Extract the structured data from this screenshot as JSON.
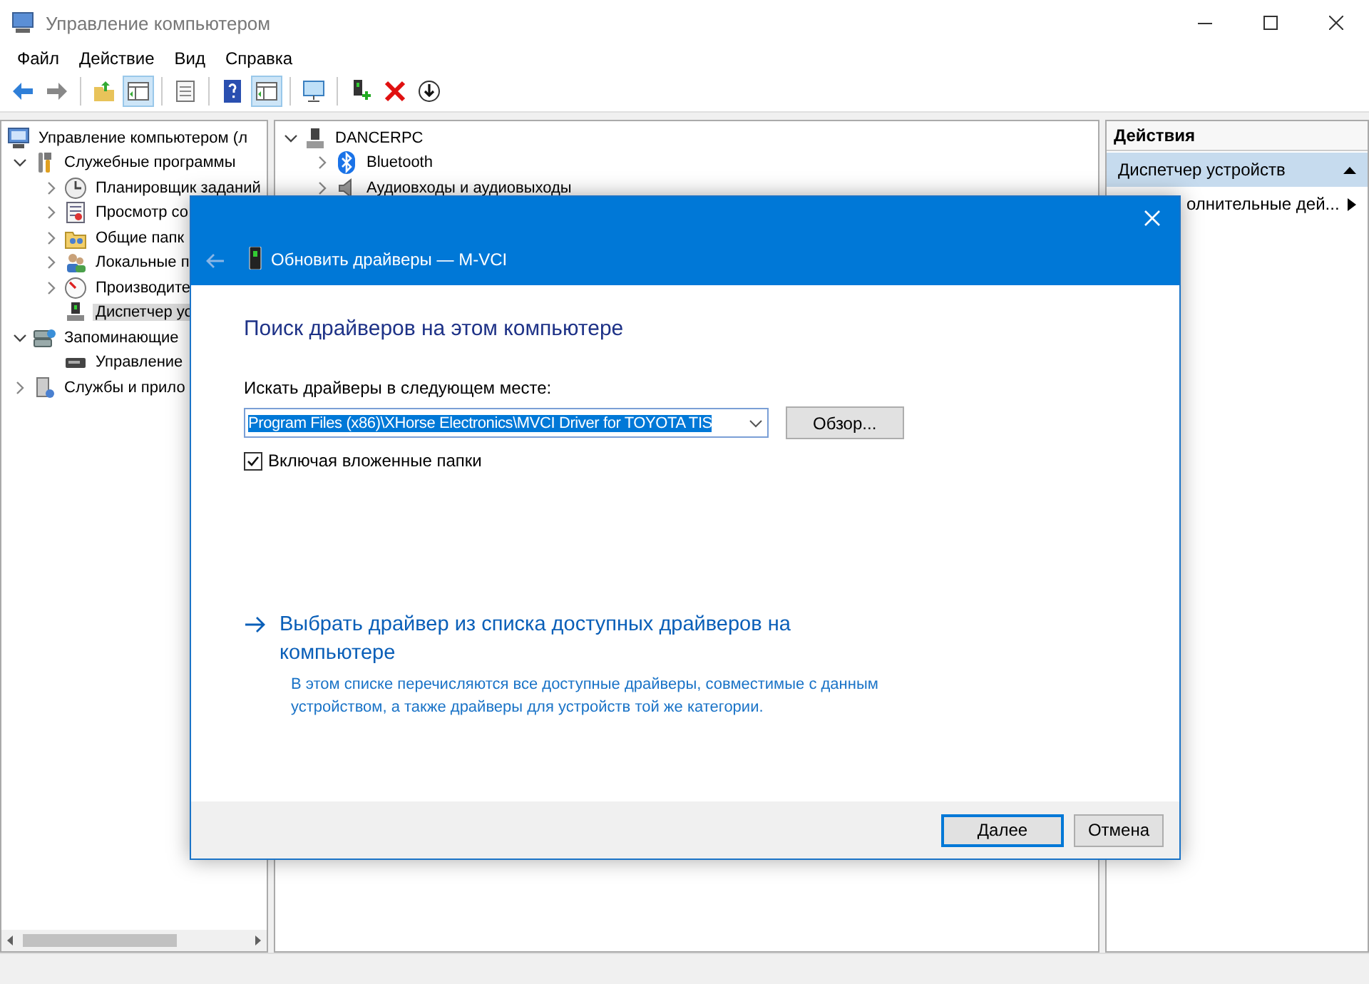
{
  "window": {
    "title": "Управление компьютером"
  },
  "menu": [
    "Файл",
    "Действие",
    "Вид",
    "Справка"
  ],
  "toolbar": [
    {
      "kind": "back",
      "pressed": false
    },
    {
      "kind": "forward",
      "pressed": false
    },
    {
      "kind": "separator"
    },
    {
      "kind": "up",
      "pressed": false
    },
    {
      "kind": "panel",
      "pressed": true
    },
    {
      "kind": "separator"
    },
    {
      "kind": "properties",
      "pressed": false
    },
    {
      "kind": "separator"
    },
    {
      "kind": "help",
      "pressed": false
    },
    {
      "kind": "panel",
      "pressed": true
    },
    {
      "kind": "separator"
    },
    {
      "kind": "monitor",
      "pressed": false
    },
    {
      "kind": "separator"
    },
    {
      "kind": "device",
      "pressed": false
    },
    {
      "kind": "delete",
      "pressed": false
    },
    {
      "kind": "download",
      "pressed": false
    }
  ],
  "navigation_tree": [
    {
      "label": "Управление компьютером (л",
      "kind": "computer",
      "selected": false,
      "children": [
        {
          "label": "Служебные программы",
          "kind": "tools",
          "expanded": true,
          "selected": false,
          "children": [
            {
              "label": "Планировщик заданий",
              "kind": "clock",
              "expanded": false,
              "selected": false
            },
            {
              "label": "Просмотр со",
              "kind": "log",
              "expanded": false,
              "selected": false
            },
            {
              "label": "Общие папк",
              "kind": "folder",
              "expanded": false,
              "selected": false
            },
            {
              "label": "Локальные п",
              "kind": "users",
              "expanded": false,
              "selected": false
            },
            {
              "label": "Производите",
              "kind": "gauge",
              "expanded": false,
              "selected": false
            },
            {
              "label": "Диспетчер ус",
              "kind": "device",
              "selected": true
            }
          ]
        },
        {
          "label": "Запоминающие",
          "kind": "storage",
          "expanded": true,
          "selected": false,
          "children": [
            {
              "label": "Управление",
              "kind": "disk",
              "selected": false
            }
          ]
        },
        {
          "label": "Службы и прило",
          "kind": "services",
          "expanded": false,
          "selected": false
        }
      ]
    }
  ],
  "device_tree": [
    {
      "label": "DANCERPC",
      "kind": "computer-small",
      "expanded": true,
      "selected": false,
      "children": [
        {
          "label": "Bluetooth",
          "kind": "bluetooth",
          "expanded": false,
          "selected": false
        },
        {
          "label": "Аудиовходы и аудиовыходы",
          "kind": "speaker",
          "expanded": false,
          "selected": false
        }
      ]
    }
  ],
  "actions": {
    "title": "Действия",
    "section": {
      "label": "Диспетчер устройств",
      "expanded": true
    },
    "items": [
      {
        "label": "олнительные дей...",
        "submenu": true
      }
    ]
  },
  "dialog": {
    "title": "Обновить драйверы — M-VCI",
    "heading": "Поиск драйверов на этом компьютере",
    "location_label": "Искать драйверы в следующем месте:",
    "location_value": "Program Files (x86)\\XHorse Electronics\\MVCI Driver for TOYOTA TIS",
    "value_selected": true,
    "browse_button": "Обзор...",
    "include_subfolders": {
      "label": "Включая вложенные папки",
      "checked": true
    },
    "choose_link": {
      "label": "Выбрать драйвер из списка доступных драйверов на компьютере",
      "description": "В этом списке перечисляются все доступные драйверы, совместимые с данным устройством, а также драйверы для устройств той же категории."
    },
    "buttons": [
      {
        "label": "Далее",
        "default": true
      },
      {
        "label": "Отмена",
        "default": false
      }
    ]
  }
}
